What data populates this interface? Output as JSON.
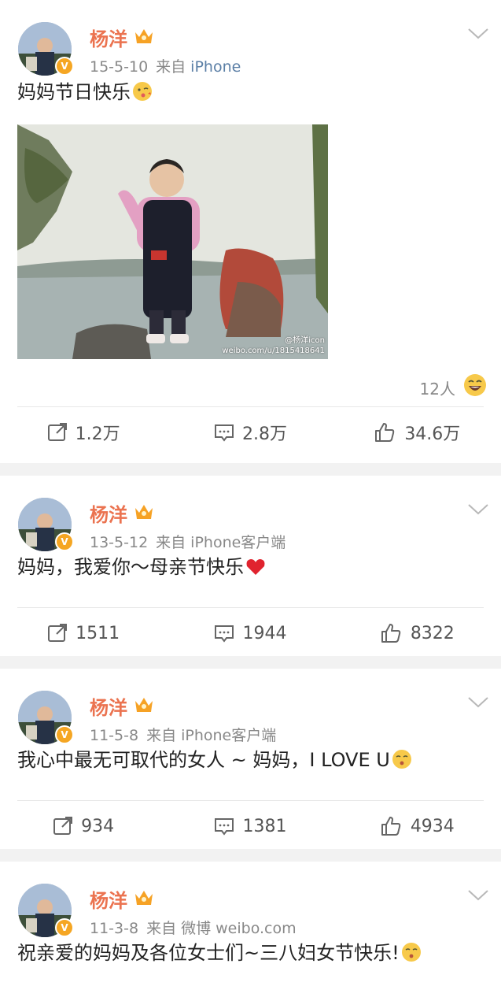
{
  "posts": [
    {
      "author": "杨洋",
      "date": "15-5-10",
      "source_prefix": "来自",
      "source": "iPhone",
      "text": "妈妈节日快乐",
      "has_image": true,
      "image_watermark_name": "@杨洋icon",
      "image_watermark_url": "weibo.com/u/1815418641",
      "likes_summary": "12人",
      "repost": "1.2万",
      "comment": "2.8万",
      "like": "34.6万"
    },
    {
      "author": "杨洋",
      "date": "13-5-12",
      "source_prefix": "来自",
      "source": "iPhone客户端",
      "text": "妈妈，我爱你～母亲节快乐",
      "repost": "1511",
      "comment": "1944",
      "like": "8322"
    },
    {
      "author": "杨洋",
      "date": "11-5-8",
      "source_prefix": "来自",
      "source": "iPhone客户端",
      "text": "我心中最无可取代的女人 ~ 妈妈，I LOVE U",
      "repost": "934",
      "comment": "1381",
      "like": "4934"
    },
    {
      "author": "杨洋",
      "date": "11-3-8",
      "source_prefix": "来自",
      "source": "微博 weibo.com",
      "text": "祝亲爱的妈妈及各位女士们~三八妇女节快乐!"
    }
  ],
  "icons": {
    "verified": "verified-v-icon",
    "crown": "vip-crown-icon",
    "repost": "repost-icon",
    "comment": "comment-icon",
    "like": "thumbs-up-icon",
    "menu": "chevron-down-icon"
  },
  "colors": {
    "name": "#eb7350",
    "verified": "#f5a623",
    "link": "#5b7fa6"
  }
}
